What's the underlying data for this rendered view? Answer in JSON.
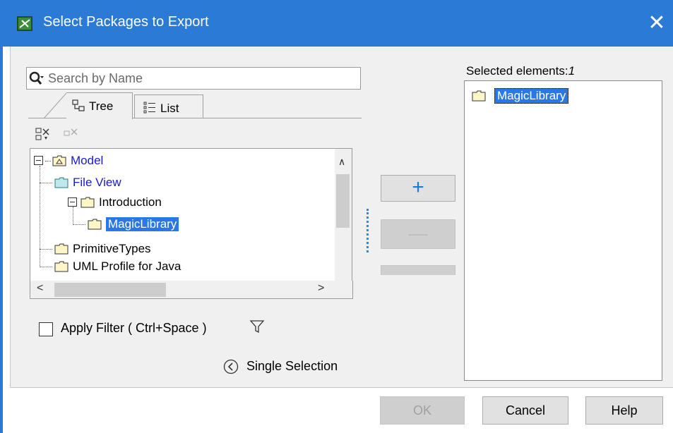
{
  "window": {
    "title": "Select Packages to Export",
    "close_symbol": "✕"
  },
  "search": {
    "placeholder": "Search by Name",
    "value": ""
  },
  "tabs": [
    {
      "label": "Tree",
      "icon": "tree-icon",
      "active": true
    },
    {
      "label": "List",
      "icon": "list-icon",
      "active": false
    }
  ],
  "tree": {
    "nodes": [
      {
        "label": "Model",
        "icon": "model-package-icon",
        "expanded": true,
        "color": "#1a1ad6"
      },
      {
        "label": "File View",
        "icon": "file-view-folder-icon",
        "color": "#1a1ad6"
      },
      {
        "label": "Introduction",
        "icon": "folder-icon",
        "expanded": true
      },
      {
        "label": "MagicLibrary",
        "icon": "folder-icon",
        "selected": true
      },
      {
        "label": "PrimitiveTypes",
        "icon": "folder-icon"
      },
      {
        "label": "UML Profile for Java",
        "icon": "folder-icon"
      }
    ]
  },
  "filter": {
    "label": "Apply Filter ( Ctrl+Space )",
    "checked": false
  },
  "single_selection": {
    "label": "Single Selection"
  },
  "middle": {
    "add_symbol": "+",
    "remove_symbol": "—"
  },
  "selected": {
    "label": "Selected elements:",
    "count": "1",
    "items": [
      {
        "label": "MagicLibrary",
        "icon": "folder-icon"
      }
    ]
  },
  "buttons": {
    "ok": "OK",
    "cancel": "Cancel",
    "help": "Help"
  },
  "colors": {
    "titlebar": "#2b7bd6",
    "selection": "#2b78e4",
    "link_text": "#1a1ad6",
    "folder_fill": "#fff6c8"
  }
}
